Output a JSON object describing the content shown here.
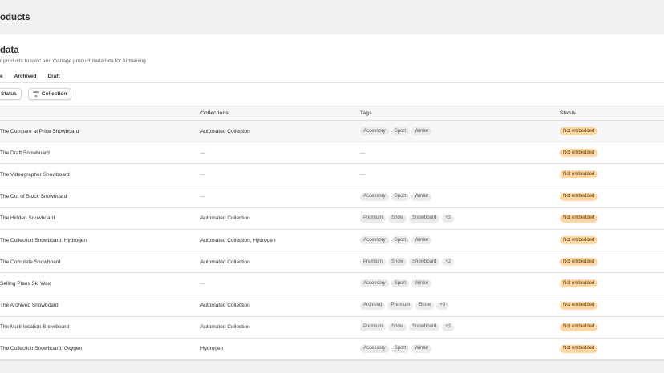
{
  "header": {
    "title": "oducts"
  },
  "page": {
    "title": "data",
    "subtitle": "r products to sync and manage product metadata for AI training"
  },
  "tabs": [
    {
      "label": "e"
    },
    {
      "label": "Archived"
    },
    {
      "label": "Draft"
    }
  ],
  "filters": [
    {
      "label": "Status"
    },
    {
      "label": "Collection",
      "icon": "filter-icon"
    }
  ],
  "table": {
    "columns": [
      "",
      "Collections",
      "Tags",
      "Status"
    ],
    "empty_value": "—",
    "rows": [
      {
        "title": "The Compare at Price Snowboard",
        "collections": "Automated Collection",
        "tags": [
          "Accessory",
          "Sport",
          "Winter"
        ],
        "status": "Not embedded"
      },
      {
        "title": "The Draft Snowboard",
        "collections": "",
        "tags": [],
        "status": "Not embedded"
      },
      {
        "title": "The Videographer Snowboard",
        "collections": "",
        "tags": [],
        "status": "Not embedded"
      },
      {
        "title": "The Out of Stock Snowboard",
        "collections": "",
        "tags": [
          "Accessory",
          "Sport",
          "Winter"
        ],
        "status": "Not embedded"
      },
      {
        "title": "The Hidden Snowboard",
        "collections": "Automated Collection",
        "tags": [
          "Premium",
          "Snow",
          "Snowboard",
          "+2"
        ],
        "status": "Not embedded"
      },
      {
        "title": "The Collection Snowboard: Hydrogen",
        "collections": "Automated Collection, Hydrogen",
        "tags": [
          "Accessory",
          "Sport",
          "Winter"
        ],
        "status": "Not embedded"
      },
      {
        "title": "The Complete Snowboard",
        "collections": "Automated Collection",
        "tags": [
          "Premium",
          "Snow",
          "Snowboard",
          "+2"
        ],
        "status": "Not embedded"
      },
      {
        "title": "Selling Plans Ski Wax",
        "collections": "",
        "tags": [
          "Accessory",
          "Sport",
          "Winter"
        ],
        "status": "Not embedded"
      },
      {
        "title": "The Archived Snowboard",
        "collections": "Automated Collection",
        "tags": [
          "Archived",
          "Premium",
          "Snow",
          "+3"
        ],
        "status": "Not embedded"
      },
      {
        "title": "The Multi-location Snowboard",
        "collections": "Automated Collection",
        "tags": [
          "Premium",
          "Snow",
          "Snowboard",
          "+2"
        ],
        "status": "Not embedded"
      },
      {
        "title": "The Collection Snowboard: Oxygen",
        "collections": "Hydrogen",
        "tags": [
          "Accessory",
          "Sport",
          "Winter"
        ],
        "status": "Not embedded"
      }
    ]
  },
  "colors": {
    "status_badge_bg": "#ffd6a4",
    "status_badge_text": "#5e4200",
    "tag_bg": "#ebebeb"
  }
}
